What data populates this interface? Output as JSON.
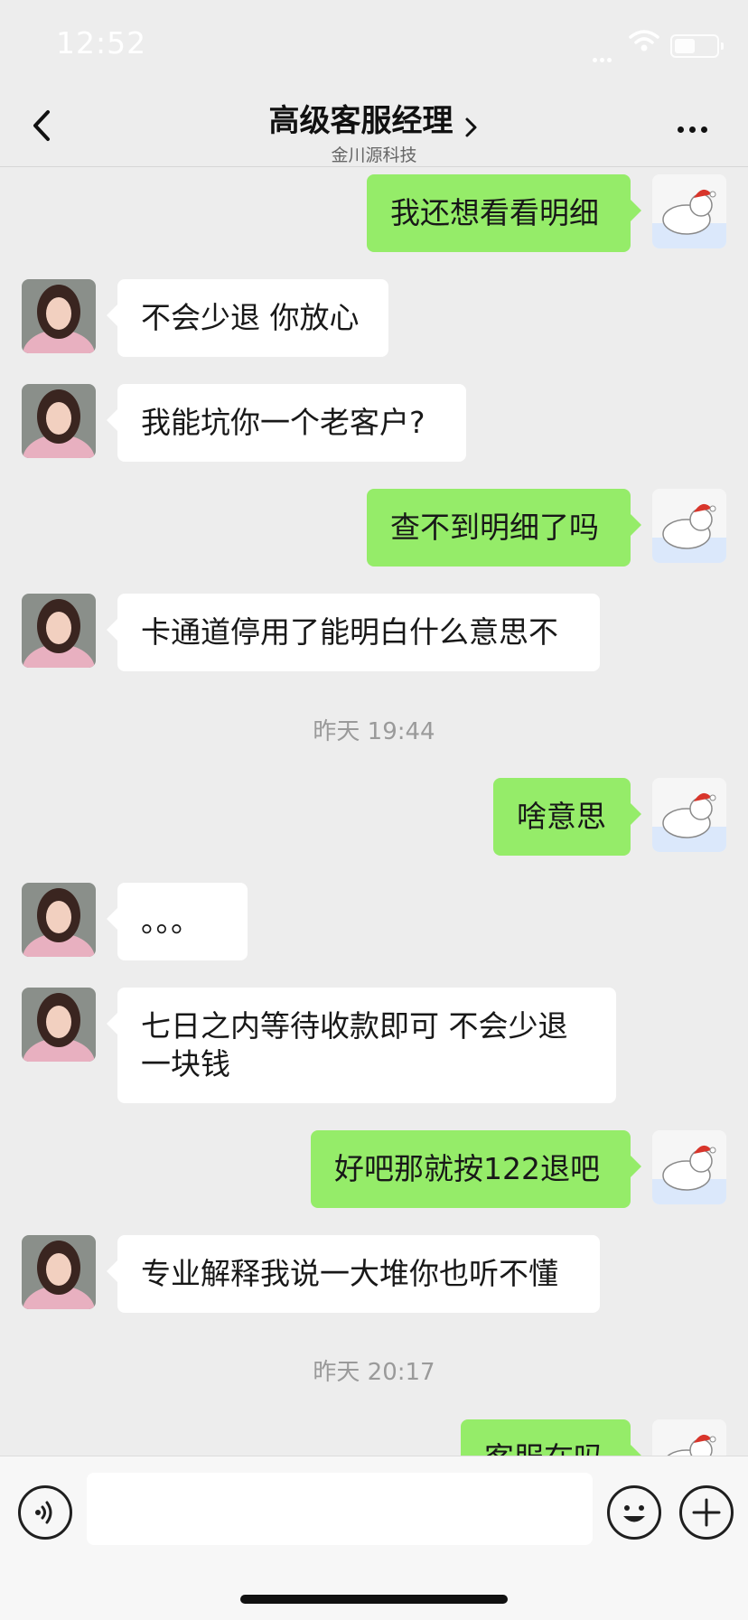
{
  "status_bar": {
    "time": "12:52"
  },
  "nav": {
    "title": "高级客服经理",
    "subtitle": "金川源科技"
  },
  "messages": [
    {
      "side": "right",
      "text": "我还想看看明细"
    },
    {
      "side": "left",
      "text": "不会少退 你放心"
    },
    {
      "side": "left",
      "text": "我能坑你一个老客户?"
    },
    {
      "side": "right",
      "text": "查不到明细了吗"
    },
    {
      "side": "left",
      "text": "卡通道停用了能明白什么意思不"
    },
    {
      "type": "timestamp",
      "text": "昨天 19:44"
    },
    {
      "side": "right",
      "text": "啥意思"
    },
    {
      "side": "left",
      "text": "。。。"
    },
    {
      "side": "left",
      "text": "七日之内等待收款即可  不会少退一块钱"
    },
    {
      "side": "right",
      "text": "好吧那就按122退吧"
    },
    {
      "side": "left",
      "text": "专业解释我说一大堆你也听不懂"
    },
    {
      "type": "timestamp",
      "text": "昨天 20:17"
    },
    {
      "side": "right",
      "text": "客服在吗"
    }
  ],
  "colors": {
    "background": "#ededed",
    "outgoing_bubble": "#95ec69",
    "incoming_bubble": "#ffffff"
  },
  "icons": [
    "back-chevron-icon",
    "more-icon",
    "voice-icon",
    "emoji-icon",
    "plus-icon",
    "wifi-icon",
    "battery-icon"
  ]
}
